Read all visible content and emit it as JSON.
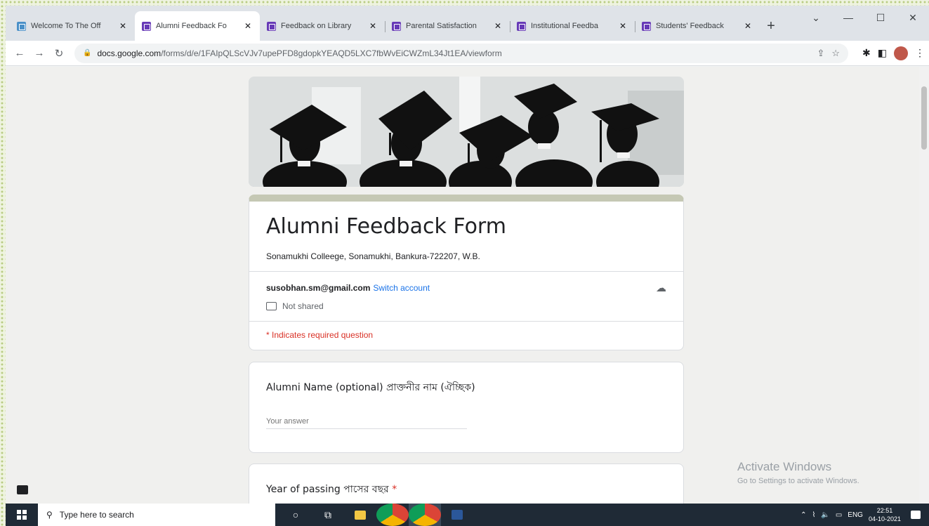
{
  "browser": {
    "tabs": [
      {
        "title": "Welcome To The Off",
        "favicon": "site-icon",
        "active": false
      },
      {
        "title": "Alumni Feedback Fo",
        "favicon": "google-forms-icon",
        "active": true
      },
      {
        "title": "Feedback on Library",
        "favicon": "google-forms-icon",
        "active": false
      },
      {
        "title": "Parental Satisfaction",
        "favicon": "google-forms-icon",
        "active": false
      },
      {
        "title": "Institutional Feedba",
        "favicon": "google-forms-icon",
        "active": false
      },
      {
        "title": "Students' Feedback",
        "favicon": "google-forms-icon",
        "active": false
      }
    ],
    "new_tab": "+",
    "url_host": "docs.google.com",
    "url_path": "/forms/d/e/1FAIpQLScVJv7upePFD8gdopkYEAQD5LXC7fbWvEiCWZmL34Jt1EA/viewform"
  },
  "form": {
    "title": "Alumni Feedback Form",
    "description": "Sonamukhi Colleege, Sonamukhi, Bankura-722207, W.B.",
    "account_email": "susobhan.sm@gmail.com",
    "switch_account": "Switch account",
    "not_shared": "Not shared",
    "required_note": "* Indicates required question",
    "questions": [
      {
        "label": "Alumni Name (optional) প্রাক্তনীর নাম (ঐচ্ছিক)",
        "placeholder": "Your answer"
      },
      {
        "label": "Year of passing পাসের বছর",
        "required_mark": "*"
      }
    ]
  },
  "watermark": {
    "line1": "Activate Windows",
    "line2": "Go to Settings to activate Windows."
  },
  "taskbar": {
    "search_placeholder": "Type here to search",
    "language": "ENG",
    "time": "22:51",
    "date": "04-10-2021"
  },
  "colors": {
    "form_accent": "#673ab7",
    "header_stripe": "#c5c8b4",
    "link": "#1a73e8",
    "required": "#d93025"
  }
}
